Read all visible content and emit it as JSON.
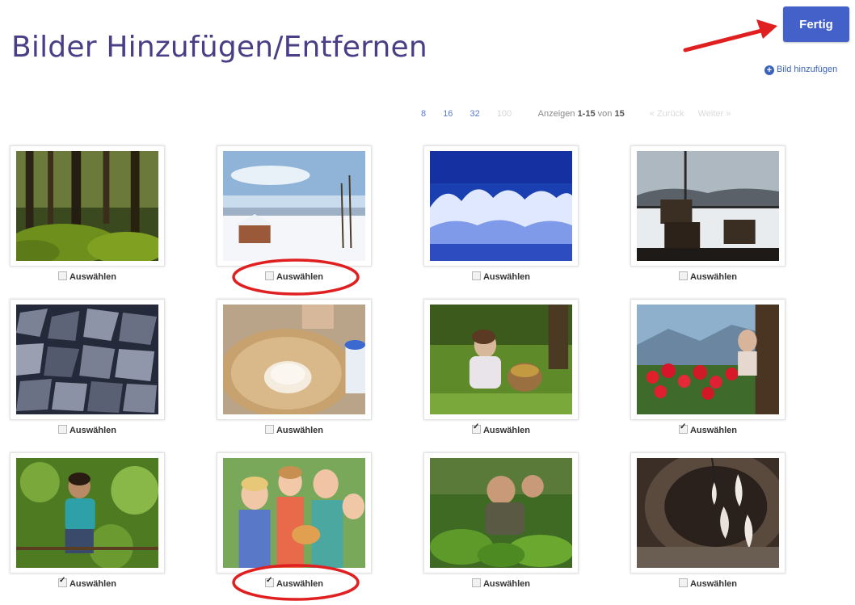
{
  "header": {
    "title": "Bilder Hinzufügen/Entfernen",
    "done_label": "Fertig",
    "add_image_label": "Bild hinzufügen"
  },
  "pager": {
    "per_page": [
      "8",
      "16",
      "32",
      "100"
    ],
    "info_prefix": "Anzeigen ",
    "info_range": "1-15",
    "info_mid": " von ",
    "info_total": "15",
    "prev_label": "« Zurück",
    "next_label": "Weiter »"
  },
  "select_label": "Auswählen",
  "images": [
    {
      "subject": "mossy forest",
      "checked": false
    },
    {
      "subject": "snowy hut by lake",
      "checked": false
    },
    {
      "subject": "frosted trees blue sky",
      "checked": false
    },
    {
      "subject": "chairs by window snow",
      "checked": false
    },
    {
      "subject": "stacked firewood",
      "checked": false
    },
    {
      "subject": "dough in wooden bowl",
      "checked": false
    },
    {
      "subject": "child with basket in meadow",
      "checked": true
    },
    {
      "subject": "red flowers on balcony",
      "checked": true
    },
    {
      "subject": "boy climbing tree",
      "checked": true
    },
    {
      "subject": "children holding cat",
      "checked": true
    },
    {
      "subject": "gardening in vegetable patch",
      "checked": false
    },
    {
      "subject": "hanging cheese cloths",
      "checked": false
    }
  ],
  "colors": {
    "title": "#4a3f87",
    "primary": "#4361c9",
    "annotation": "#e02020"
  }
}
